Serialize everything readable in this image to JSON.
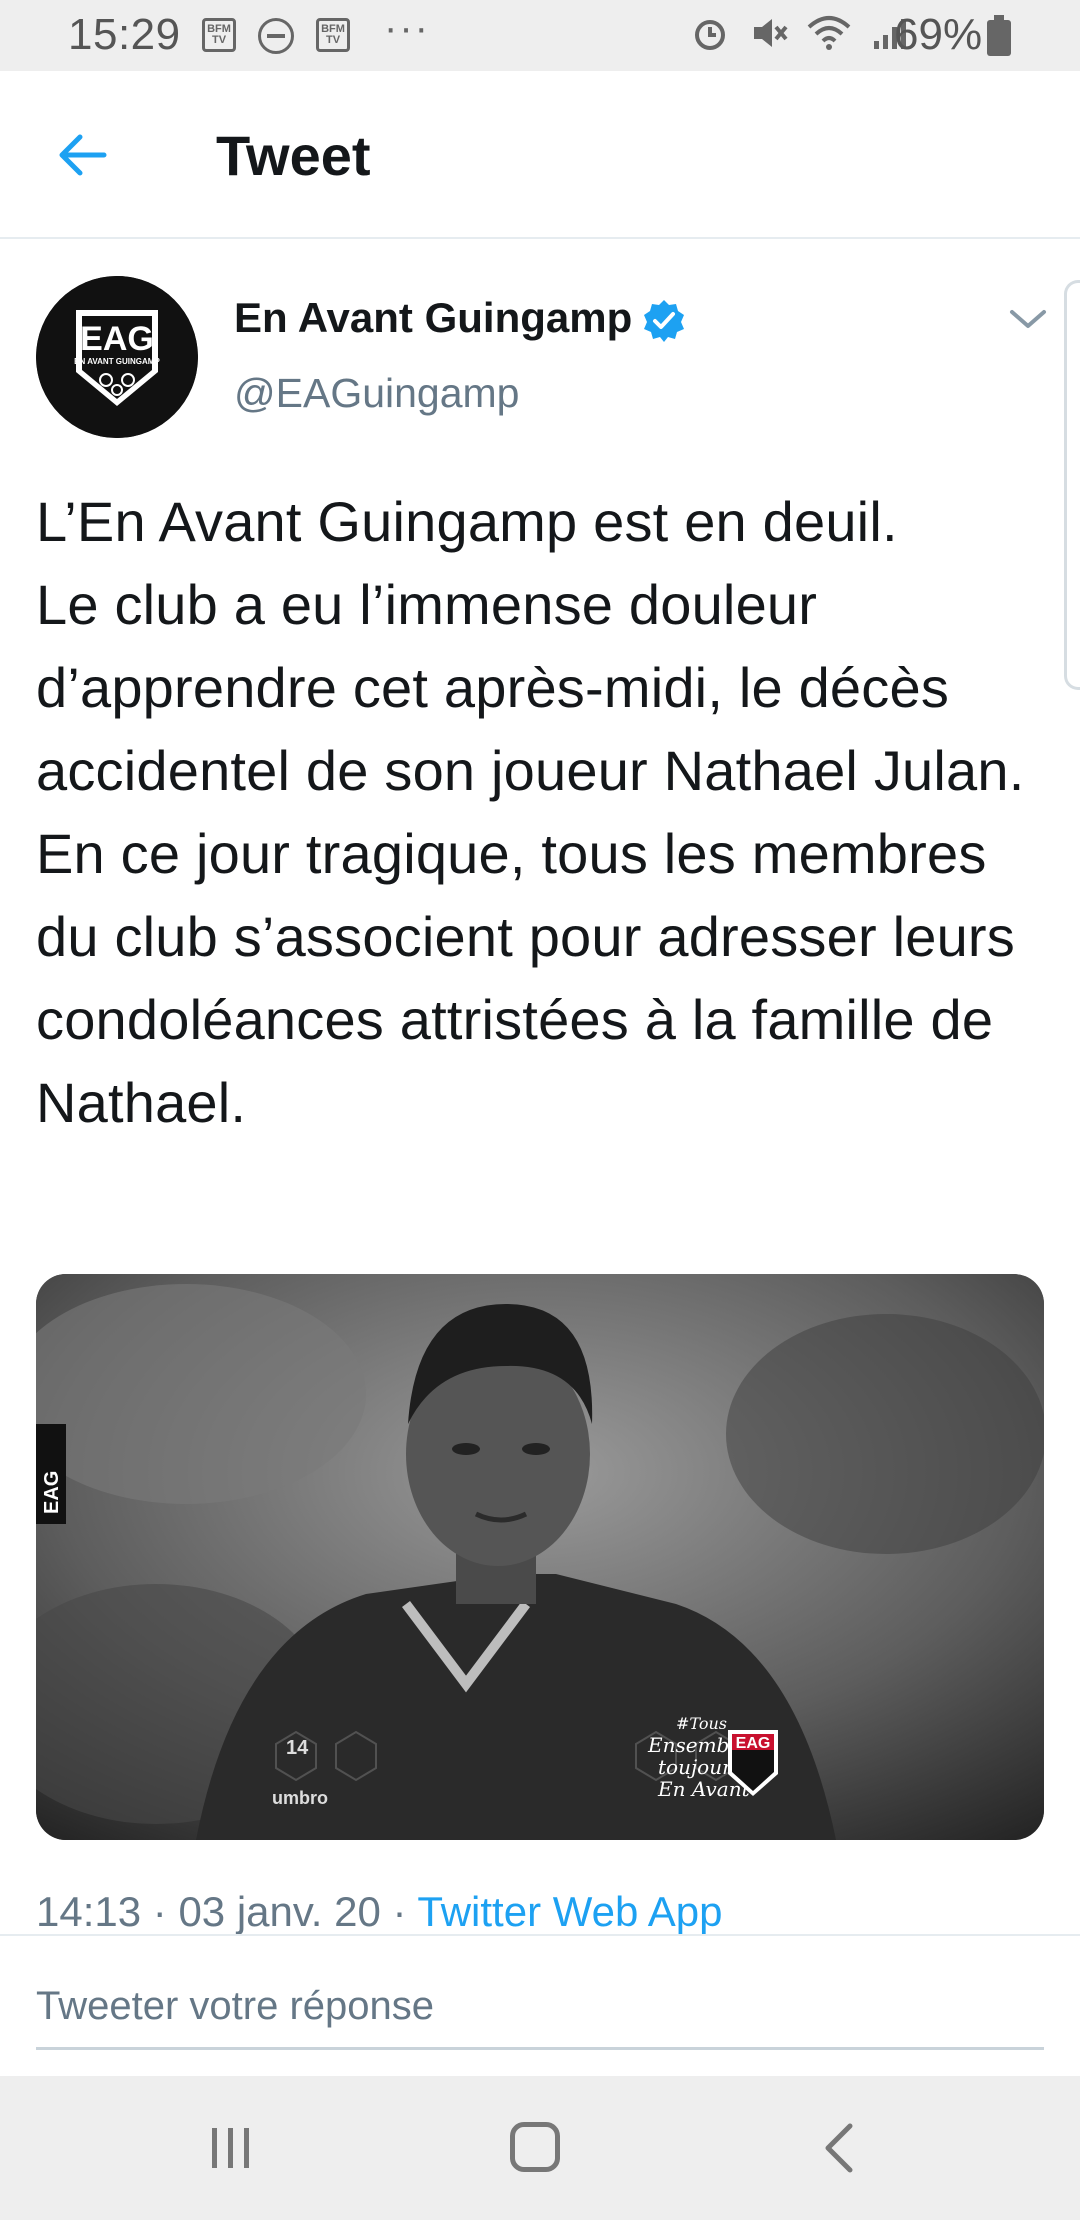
{
  "status_bar": {
    "time": "15:29",
    "left_icons": [
      "bfm-tv-icon",
      "do-not-disturb-icon",
      "bfm-tv-icon",
      "more-icon"
    ],
    "bfm_label": "BFM TV",
    "more": "···",
    "right_icons": [
      "alarm-icon",
      "mute-icon",
      "wifi-icon",
      "signal-icon",
      "battery-icon"
    ],
    "battery_percent": "69%"
  },
  "header": {
    "title": "Tweet",
    "back_icon": "arrow-left-icon",
    "accent_color": "#1da1f2"
  },
  "tweet": {
    "author_name": "En Avant Guingamp",
    "author_handle": "@EAGuingamp",
    "verified": true,
    "avatar_logo_text": "EAG",
    "avatar_logo_subtext": "EN AVANT GUINGAMP",
    "text": "L’En Avant Guingamp est en deuil.\nLe club a eu l’immense douleur d’apprendre cet après-midi, le décès accidentel de son joueur Nathael Julan.\nEn ce jour tragique, tous les membres du club s’associent pour adresser leurs condoléances attristées à la famille de Nathael.",
    "media": {
      "side_label": "EAG",
      "jersey_number": "14",
      "jersey_brand": "umbro",
      "slogan_lines": [
        "#Tous",
        "Ensemble",
        "toujours",
        "En Avant"
      ],
      "badge_text": "EAG"
    },
    "time": "14:13",
    "date": "03 janv. 20",
    "separator": " · ",
    "source": "Twitter Web App"
  },
  "reply": {
    "placeholder": "Tweeter votre réponse"
  },
  "nav": {
    "icons": [
      "recent-apps-icon",
      "home-icon",
      "back-icon"
    ]
  }
}
